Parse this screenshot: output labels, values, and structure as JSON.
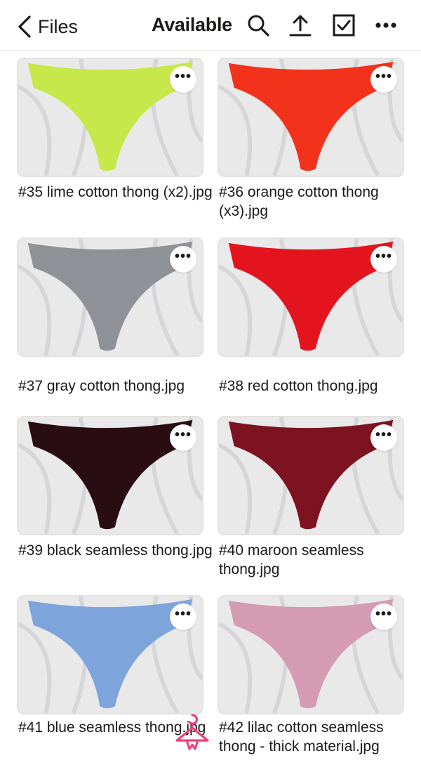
{
  "header": {
    "back_label": "Files",
    "title": "Available",
    "icons": [
      "search-icon",
      "upload-icon",
      "select-checkbox-icon",
      "more-options-icon"
    ]
  },
  "files": [
    {
      "name": "#35 lime cotton thong (x2).jpg",
      "color": "#c6e84a"
    },
    {
      "name": "#36 orange cotton thong (x3).jpg",
      "color": "#f2321a"
    },
    {
      "name": "#37 gray cotton thong.jpg",
      "color": "#8e9296"
    },
    {
      "name": "#38 red cotton thong.jpg",
      "color": "#e4141e"
    },
    {
      "name": "#39 black seamless thong.jpg",
      "color": "#2a0d12"
    },
    {
      "name": "#40 maroon seamless thong.jpg",
      "color": "#7d1220"
    },
    {
      "name": "#41 blue seamless thong.jpg",
      "color": "#7ea4dc"
    },
    {
      "name": "#42 lilac cotton seamless thong - thick material.jpg",
      "color": "#d49bb3"
    }
  ],
  "more_button_glyph": "•••",
  "colors": {
    "accent_watermark": "#ec3f7f",
    "border": "#e4e2df"
  }
}
